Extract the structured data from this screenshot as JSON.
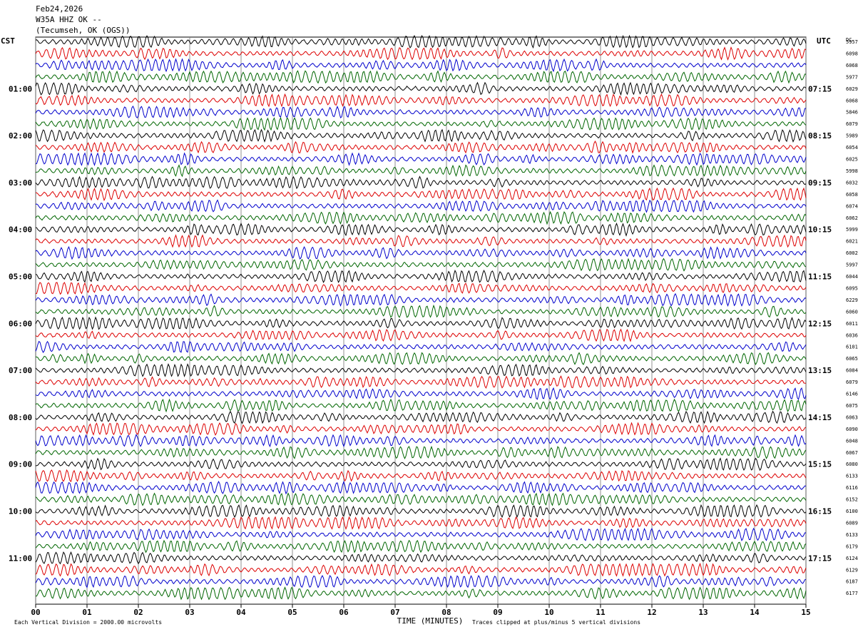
{
  "header": {
    "date": "Feb24,2026",
    "station": "W35A HHZ OK --",
    "location": "(Tecumseh, OK (OGS))"
  },
  "left_axis_label": "CST",
  "right_axis_label": "UTC",
  "dc_label": "DC",
  "footer": {
    "x_axis_title": "TIME (MINUTES)",
    "scale_note": "Each Vertical Division = 2000.00 microvolts",
    "clip_note": "Traces clipped at plus/minus 5 vertical divisions"
  },
  "chart_data": {
    "type": "line",
    "x_range": [
      0,
      15
    ],
    "x_ticks": [
      "00",
      "01",
      "02",
      "03",
      "04",
      "05",
      "06",
      "07",
      "08",
      "09",
      "10",
      "11",
      "12",
      "13",
      "14",
      "15"
    ],
    "trace_colors": [
      "#000000",
      "#dd0000",
      "#0000cc",
      "#006600"
    ],
    "grid": "vertical lines at each minute",
    "cst_hour_labels": [
      "01:00",
      "02:00",
      "03:00",
      "04:00",
      "05:00",
      "06:00",
      "07:00",
      "08:00",
      "09:00",
      "10:00",
      "11:00"
    ],
    "utc_hour_labels": [
      "07:15",
      "08:15",
      "09:15",
      "10:15",
      "11:15",
      "12:15",
      "13:15",
      "14:15",
      "15:15",
      "16:15",
      "17:15"
    ],
    "dc_values": [
      "5957",
      "6098",
      "6068",
      "5977",
      "6029",
      "6068",
      "5846",
      "6079",
      "5989",
      "6054",
      "6025",
      "5998",
      "6032",
      "6058",
      "6074",
      "6062",
      "5999",
      "6021",
      "6002",
      "5997",
      "6044",
      "6095",
      "6229",
      "6060",
      "6011",
      "6036",
      "6101",
      "6065",
      "6084",
      "6079",
      "6146",
      "6075",
      "6063",
      "6090",
      "6048",
      "6067",
      "6080",
      "6133",
      "6116",
      "6152",
      "6100",
      "6089",
      "6133",
      "6179",
      "6124",
      "6129",
      "6187",
      "6177"
    ]
  }
}
